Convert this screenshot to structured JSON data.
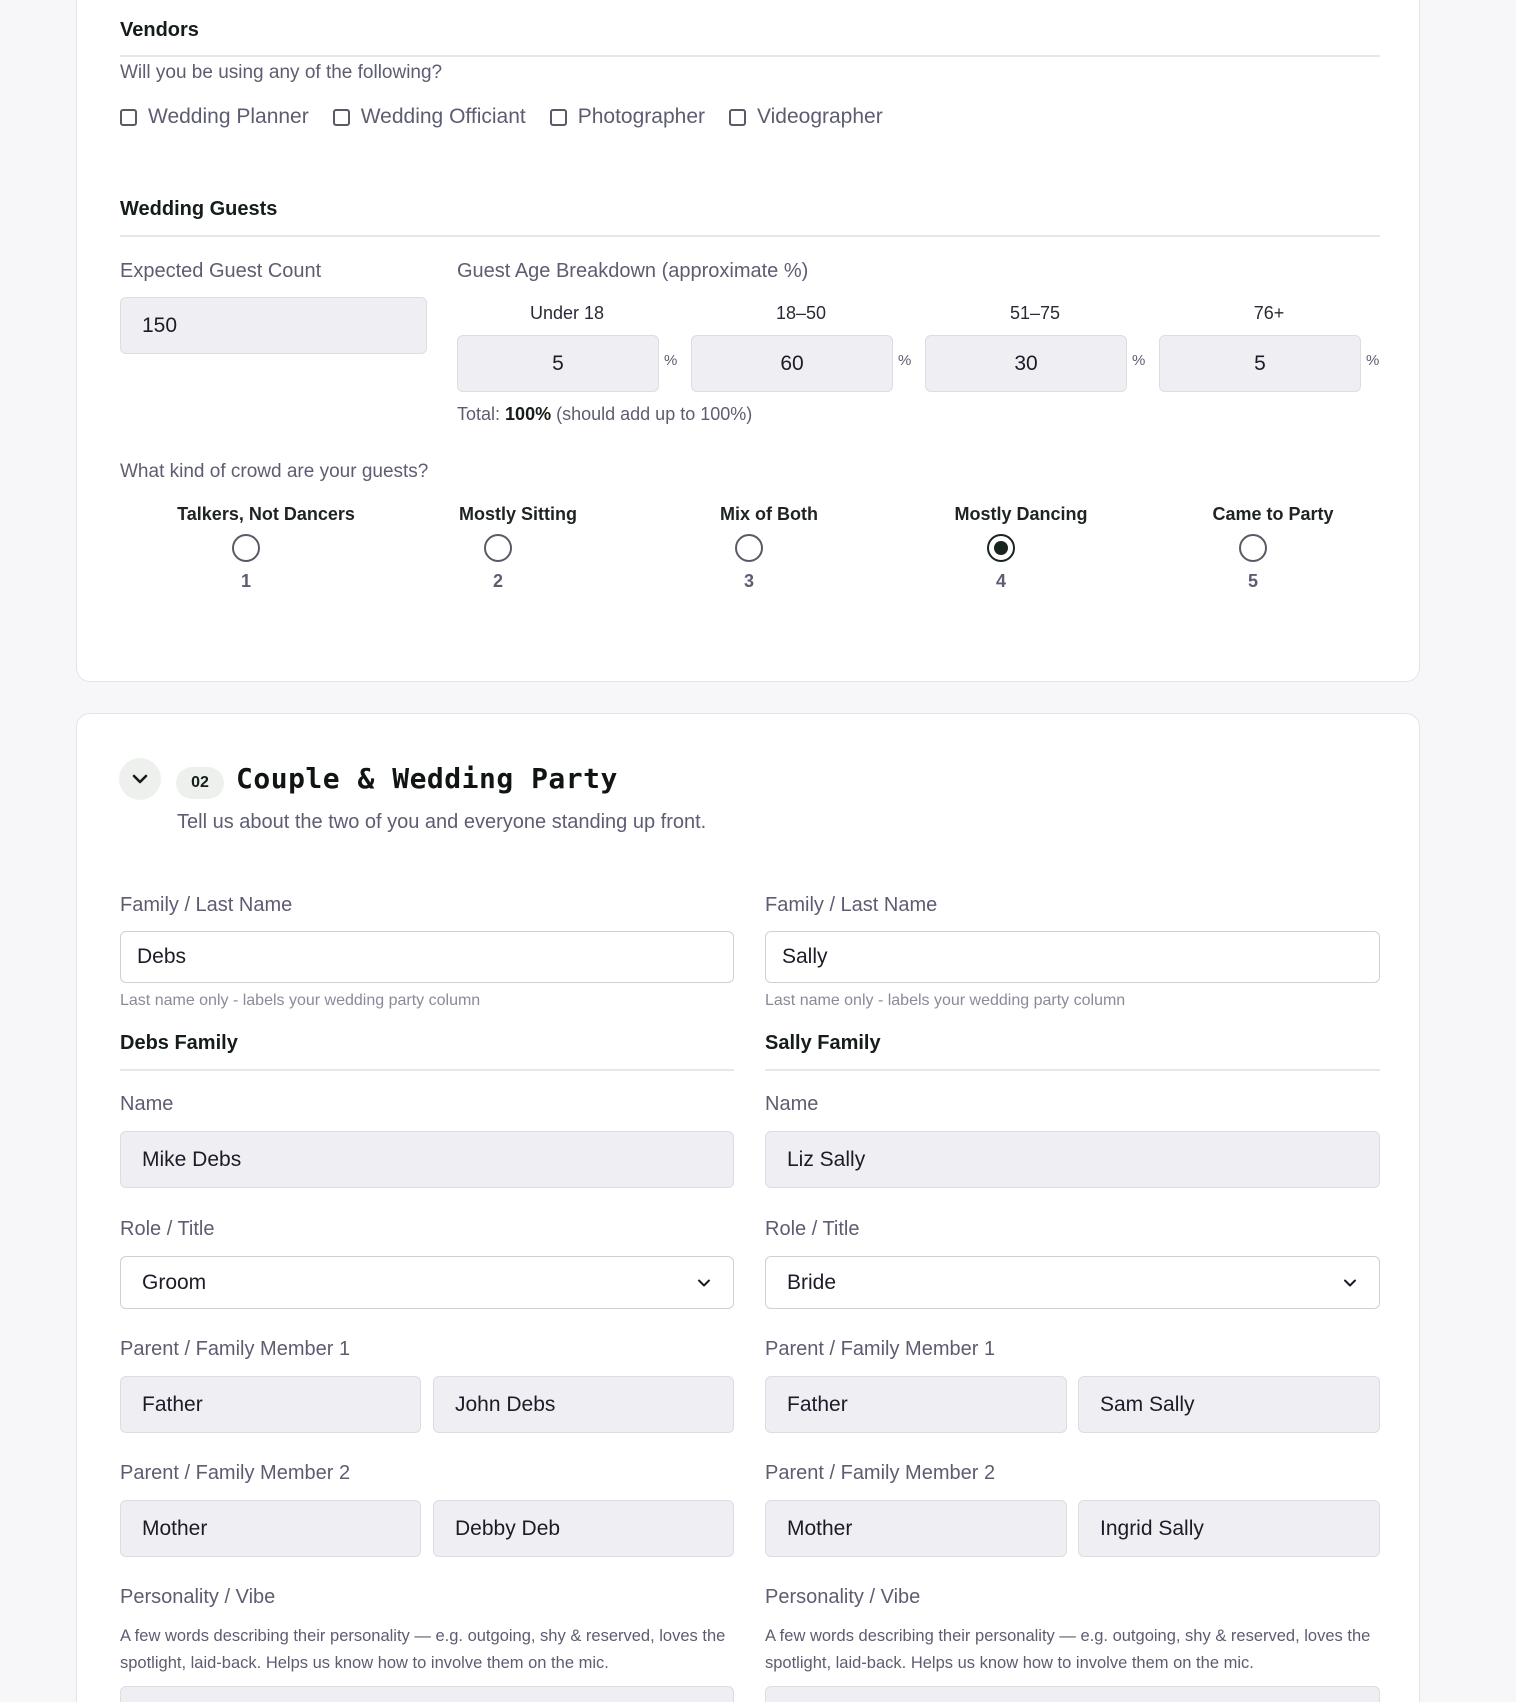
{
  "vendors": {
    "title": "Vendors",
    "question": "Will you be using any of the following?",
    "options": [
      "Wedding Planner",
      "Wedding Officiant",
      "Photographer",
      "Videographer"
    ]
  },
  "guests": {
    "title": "Wedding Guests",
    "count_label": "Expected Guest Count",
    "count_value": "150",
    "age_label": "Guest Age Breakdown",
    "age_label_suffix": "(approximate %)",
    "age_groups": [
      {
        "label": "Under 18",
        "value": "5"
      },
      {
        "label": "18–50",
        "value": "60"
      },
      {
        "label": "51–75",
        "value": "30"
      },
      {
        "label": "76+",
        "value": "5"
      }
    ],
    "percent_sign": "%",
    "total_prefix": "Total:",
    "total_value": "100%",
    "total_suffix": "(should add up to 100%)",
    "crowd_question": "What kind of crowd are your guests?",
    "crowd_options": [
      {
        "label": "Talkers, Not Dancers",
        "num": "1"
      },
      {
        "label": "Mostly Sitting",
        "num": "2"
      },
      {
        "label": "Mix of Both",
        "num": "3"
      },
      {
        "label": "Mostly Dancing",
        "num": "4"
      },
      {
        "label": "Came to Party",
        "num": "5"
      }
    ],
    "crowd_selected": 4
  },
  "section2": {
    "number": "02",
    "title": "Couple & Wedding Party",
    "subtitle": "Tell us about the two of you and everyone standing up front.",
    "icon": "chevron-down-icon",
    "columns": [
      {
        "last_name_label": "Family / Last Name",
        "last_name_value": "Debs",
        "last_name_hint": "Last name only - labels your wedding party column",
        "family_title": "Debs Family",
        "name_label": "Name",
        "name_value": "Mike Debs",
        "role_label": "Role / Title",
        "role_value": "Groom",
        "parent1_label": "Parent / Family Member 1",
        "parent1_relation": "Father",
        "parent1_name": "John Debs",
        "parent2_label": "Parent / Family Member 2",
        "parent2_relation": "Mother",
        "parent2_name": "Debby Deb",
        "personality_label": "Personality / Vibe",
        "personality_desc": "A few words describing their personality — e.g. outgoing, shy & reserved, loves the spotlight, laid-back. Helps us know how to involve them on the mic."
      },
      {
        "last_name_label": "Family / Last Name",
        "last_name_value": "Sally",
        "last_name_hint": "Last name only - labels your wedding party column",
        "family_title": "Sally Family",
        "name_label": "Name",
        "name_value": "Liz Sally",
        "role_label": "Role / Title",
        "role_value": "Bride",
        "parent1_label": "Parent / Family Member 1",
        "parent1_relation": "Father",
        "parent1_name": "Sam Sally",
        "parent2_label": "Parent / Family Member 2",
        "parent2_relation": "Mother",
        "parent2_name": "Ingrid Sally",
        "personality_label": "Personality / Vibe",
        "personality_desc": "A few words describing their personality — e.g. outgoing, shy & reserved, loves the spotlight, laid-back. Helps us know how to involve them on the mic."
      }
    ]
  },
  "colors": {
    "page_bg": "#f7f7fa",
    "accent": "#17261d",
    "input_bg": "#eeeef3",
    "muted_text": "#5d5d72"
  }
}
